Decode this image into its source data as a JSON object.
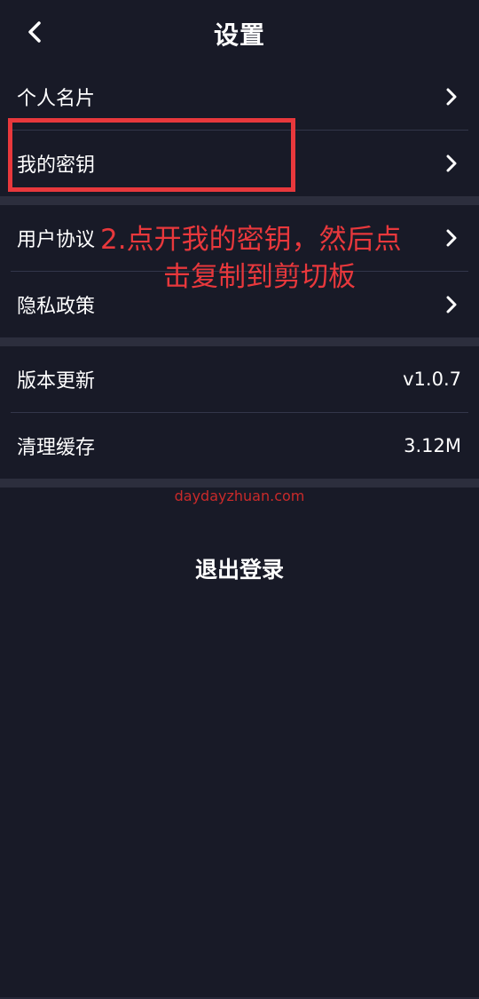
{
  "header": {
    "title": "设置",
    "back_icon": "chevron-left-icon"
  },
  "group1": {
    "items": [
      {
        "label": "个人名片"
      },
      {
        "label": "我的密钥"
      }
    ]
  },
  "group2": {
    "items": [
      {
        "label": "用户协议"
      },
      {
        "label": "隐私政策"
      }
    ]
  },
  "group3": {
    "items": [
      {
        "label": "版本更新",
        "value": "v1.0.7"
      },
      {
        "label": "清理缓存",
        "value": "3.12M"
      }
    ]
  },
  "annotation": {
    "line1": "2.点开我的密钥，然后点",
    "line2": "击复制到剪切板",
    "color": "#e8383c"
  },
  "watermark": "daydayzhuan.com",
  "logout_label": "退出登录",
  "colors": {
    "background": "#181a27",
    "separator": "#2c2e3d",
    "text": "#ffffff"
  }
}
